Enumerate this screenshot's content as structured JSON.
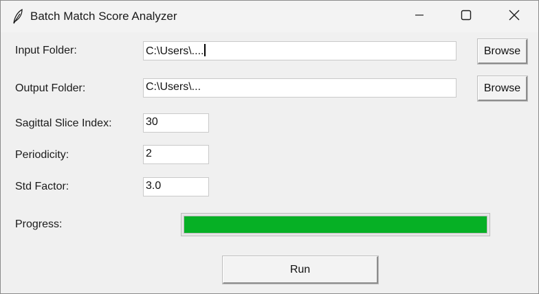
{
  "window": {
    "title": "Batch Match Score Analyzer",
    "icon": "feather-icon",
    "controls": [
      "minimize-icon",
      "maximize-icon",
      "close-icon"
    ]
  },
  "form": {
    "input_folder": {
      "label": "Input Folder:",
      "value": "C:\\Users\\....",
      "button": "Browse"
    },
    "output_folder": {
      "label": "Output Folder:",
      "value": "C:\\Users\\...",
      "button": "Browse"
    },
    "sagittal_slice": {
      "label": "Sagittal Slice Index:",
      "value": "30"
    },
    "periodicity": {
      "label": "Periodicity:",
      "value": "2"
    },
    "std_factor": {
      "label": "Std Factor:",
      "value": "3.0"
    }
  },
  "progress": {
    "label": "Progress:",
    "fraction": 1.0,
    "color": "#06b025"
  },
  "run_button": {
    "label": "Run"
  }
}
